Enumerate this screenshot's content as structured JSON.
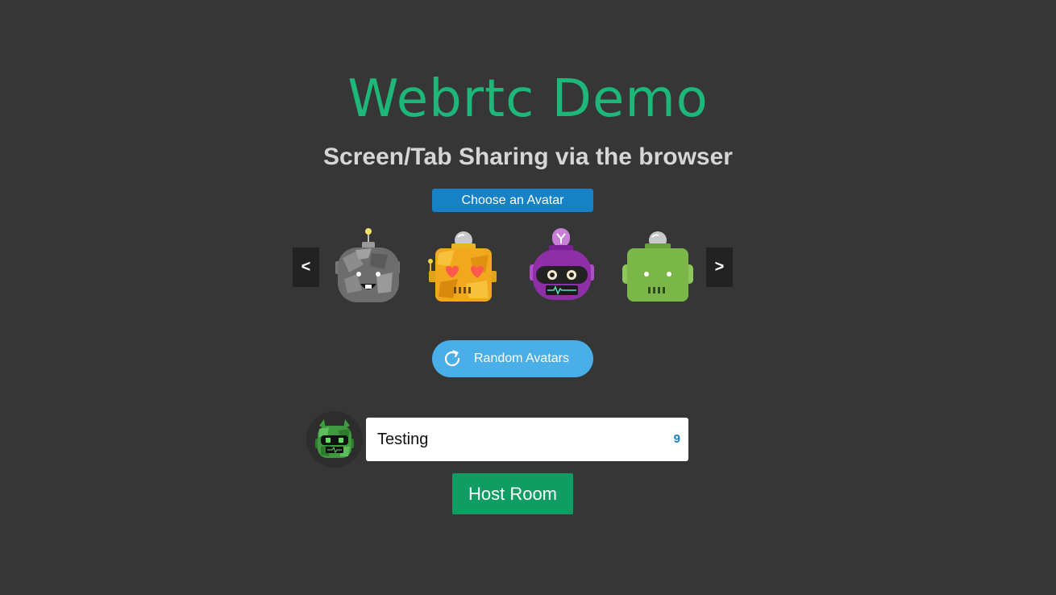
{
  "header": {
    "title": "Webrtc Demo",
    "subtitle": "Screen/Tab Sharing via the browser"
  },
  "avatar_picker": {
    "choose_label": "Choose an Avatar",
    "prev_label": "<",
    "next_label": ">",
    "options": [
      {
        "name": "gray-camo-robot",
        "color": "#8a8a8a"
      },
      {
        "name": "yellow-heart-eyes-robot",
        "color": "#f2a81d"
      },
      {
        "name": "purple-visor-robot",
        "color": "#8e2fa8"
      },
      {
        "name": "green-robot",
        "color": "#7ab648"
      }
    ],
    "random_label": "Random Avatars",
    "random_icon": "refresh-icon"
  },
  "form": {
    "selected_avatar": "green-camo-robot",
    "name_value": "Testing",
    "char_count": "9",
    "host_label": "Host Room"
  },
  "colors": {
    "background": "#363636",
    "title": "#1db77a",
    "primary_blue": "#1681c4",
    "light_blue": "#4aaee8",
    "host_green": "#0f9d63"
  }
}
